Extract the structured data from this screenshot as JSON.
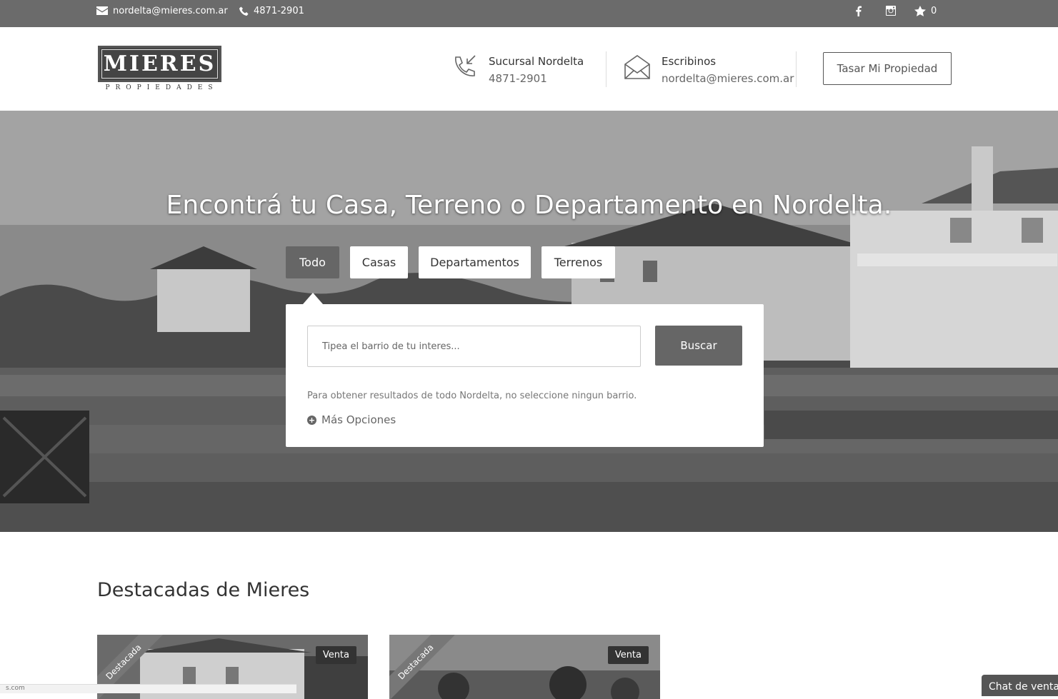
{
  "topbar": {
    "email": "nordelta@mieres.com.ar",
    "phone": "4871-2901",
    "favorites_count": "0"
  },
  "header": {
    "logo_text": "MIERES",
    "logo_sub": "PROPIEDADES",
    "branch_title": "Sucursal Nordelta",
    "branch_phone": "4871-2901",
    "write_title": "Escribinos",
    "write_email": "nordelta@mieres.com.ar",
    "cta_label": "Tasar Mi Propiedad"
  },
  "hero": {
    "title": "Encontrá tu Casa, Terreno o Departamento en Nordelta.",
    "tabs": [
      "Todo",
      "Casas",
      "Departamentos",
      "Terrenos"
    ],
    "active_tab": "Todo",
    "search_placeholder": "Tipea el barrio de tu interes...",
    "search_button": "Buscar",
    "hint": "Para obtener resultados de todo Nordelta, no seleccione ningun barrio.",
    "more_options": "Más Opciones"
  },
  "featured": {
    "title": "Destacadas de Mieres",
    "cards": [
      {
        "ribbon": "Destacada",
        "badge": "Venta"
      },
      {
        "ribbon": "Destacada",
        "badge": "Venta"
      }
    ]
  },
  "chat": {
    "label": "Chat de ventas"
  },
  "status": {
    "text": "s.com"
  }
}
